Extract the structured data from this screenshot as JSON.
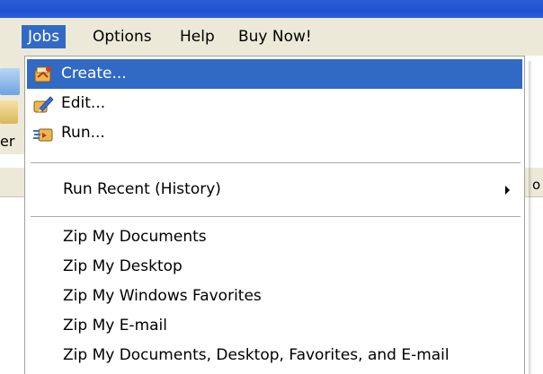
{
  "menubar": {
    "items": [
      {
        "label": "Jobs",
        "active": true
      },
      {
        "label": "Options",
        "active": false
      },
      {
        "label": "Help",
        "active": false
      },
      {
        "label": "Buy Now!",
        "active": false
      }
    ]
  },
  "background": {
    "left_text": "er",
    "right_text": "o"
  },
  "dropdown": {
    "items": [
      {
        "label": "Create...",
        "icon": "create-job-icon",
        "highlighted": true
      },
      {
        "label": "Edit...",
        "icon": "edit-job-icon",
        "highlighted": false
      },
      {
        "label": "Run...",
        "icon": "run-job-icon",
        "highlighted": false
      }
    ],
    "submenu": {
      "label": "Run Recent (History)"
    },
    "zip_items": [
      {
        "label": "Zip My Documents"
      },
      {
        "label": "Zip My Desktop"
      },
      {
        "label": "Zip My Windows Favorites"
      },
      {
        "label": "Zip My E-mail"
      },
      {
        "label": "Zip My Documents, Desktop, Favorites, and E-mail"
      }
    ]
  },
  "colors": {
    "highlight": "#316ac5",
    "menubar_bg": "#ece9d8",
    "titlebar": "#2559d6"
  }
}
